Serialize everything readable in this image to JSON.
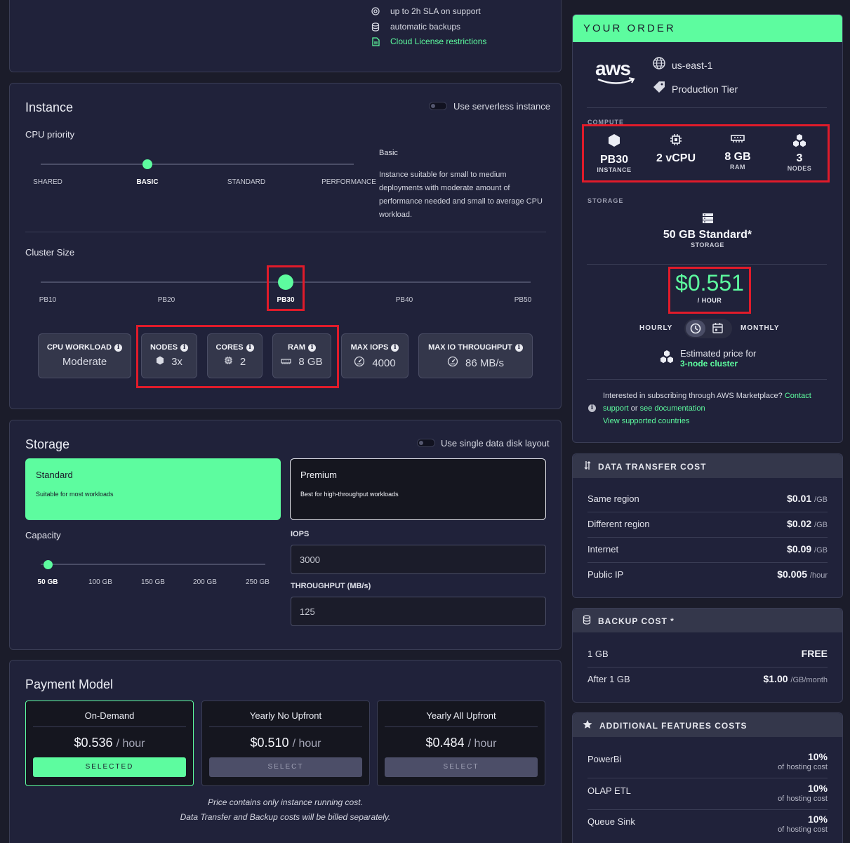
{
  "top_features": [
    {
      "icon": "support-icon",
      "text": "up to 2h SLA on support"
    },
    {
      "icon": "database-icon",
      "text": "automatic backups"
    },
    {
      "icon": "document-icon",
      "text": "Cloud License restrictions"
    }
  ],
  "instance": {
    "title": "Instance",
    "serverless_label": "Use serverless instance",
    "cpu_priority": {
      "label": "CPU priority",
      "options": [
        "SHARED",
        "BASIC",
        "STANDARD",
        "PERFORMANCE"
      ],
      "selected_index": 1,
      "desc_title": "Basic",
      "desc": "Instance suitable for small to medium deployments with moderate amount of performance needed and small to average CPU workload."
    },
    "cluster_size": {
      "label": "Cluster Size",
      "options": [
        "PB10",
        "PB20",
        "PB30",
        "PB40",
        "PB50"
      ],
      "selected_index": 2
    },
    "stats": [
      {
        "title": "CPU WORKLOAD",
        "value": "Moderate",
        "icon": ""
      },
      {
        "title": "NODES",
        "value": "3x",
        "icon": "hexagon-icon"
      },
      {
        "title": "CORES",
        "value": "2",
        "icon": "chip-icon"
      },
      {
        "title": "RAM",
        "value": "8 GB",
        "icon": "ram-icon"
      },
      {
        "title": "MAX IOPS",
        "value": "4000",
        "icon": "gauge-icon"
      },
      {
        "title": "MAX IO THROUGHPUT",
        "value": "86 MB/s",
        "icon": "gauge-icon"
      }
    ]
  },
  "storage": {
    "title": "Storage",
    "single_disk_label": "Use single data disk layout",
    "tiers": [
      {
        "name": "Standard",
        "desc": "Suitable for most workloads",
        "selected": true
      },
      {
        "name": "Premium",
        "desc": "Best for high-throughput workloads",
        "selected": false
      }
    ],
    "capacity": {
      "label": "Capacity",
      "options": [
        "50 GB",
        "100 GB",
        "150 GB",
        "200 GB",
        "250 GB"
      ],
      "selected_index": 0
    },
    "iops_label": "IOPS",
    "iops_value": "3000",
    "throughput_label": "THROUGHPUT (MB/s)",
    "throughput_value": "125"
  },
  "payment": {
    "title": "Payment Model",
    "options": [
      {
        "name": "On-Demand",
        "price": "$0.536",
        "unit": "/ hour",
        "button": "SELECTED",
        "selected": true
      },
      {
        "name": "Yearly No Upfront",
        "price": "$0.510",
        "unit": "/ hour",
        "button": "SELECT",
        "selected": false
      },
      {
        "name": "Yearly All Upfront",
        "price": "$0.484",
        "unit": "/ hour",
        "button": "SELECT",
        "selected": false
      }
    ],
    "note_1": "Price contains only instance running cost.",
    "note_2": "Data Transfer and Backup costs will be billed separately."
  },
  "order": {
    "title": "YOUR ORDER",
    "provider": "aws",
    "region": "us-east-1",
    "tier": "Production Tier",
    "compute_label": "COMPUTE",
    "compute": [
      {
        "value": "PB30",
        "caption": "INSTANCE",
        "icon": "hexagon-icon"
      },
      {
        "value": "2 vCPU",
        "caption": "",
        "icon": "chip-icon"
      },
      {
        "value": "8 GB",
        "caption": "RAM",
        "icon": "ram-icon"
      },
      {
        "value": "3",
        "caption": "NODES",
        "icon": "cluster-icon"
      }
    ],
    "storage_label": "STORAGE",
    "storage_value": "50 GB Standard*",
    "storage_caption": "STORAGE",
    "price": "$0.551",
    "price_unit": "/ HOUR",
    "hourly_label": "HOURLY",
    "monthly_label": "MONTHLY",
    "estimate_text": "Estimated price for",
    "estimate_link": "3-node cluster",
    "marketplace_text": "Interested in subscribing through AWS Marketplace?",
    "contact": "Contact",
    "support": "support",
    "or": "or",
    "see_docs": "see documentation",
    "countries": "View supported countries"
  },
  "data_transfer": {
    "title": "DATA TRANSFER COST",
    "rows": [
      {
        "label": "Same region",
        "value": "$0.01",
        "unit": "/GB"
      },
      {
        "label": "Different region",
        "value": "$0.02",
        "unit": "/GB"
      },
      {
        "label": "Internet",
        "value": "$0.09",
        "unit": "/GB"
      },
      {
        "label": "Public IP",
        "value": "$0.005",
        "unit": "/hour"
      }
    ]
  },
  "backup": {
    "title": "BACKUP COST *",
    "rows": [
      {
        "label": "1 GB",
        "value": "FREE",
        "unit": ""
      },
      {
        "label": "After 1 GB",
        "value": "$1.00",
        "unit": "/GB/month"
      }
    ]
  },
  "additional": {
    "title": "ADDITIONAL FEATURES COSTS",
    "rows": [
      {
        "label": "PowerBi",
        "value": "10%",
        "sub": "of hosting cost"
      },
      {
        "label": "OLAP ETL",
        "value": "10%",
        "sub": "of hosting cost"
      },
      {
        "label": "Queue Sink",
        "value": "10%",
        "sub": "of hosting cost"
      }
    ]
  },
  "colors": {
    "accent": "#5dfc9f",
    "highlight": "#e01b2a",
    "background": "#1b1c2a",
    "card": "#20223a"
  }
}
